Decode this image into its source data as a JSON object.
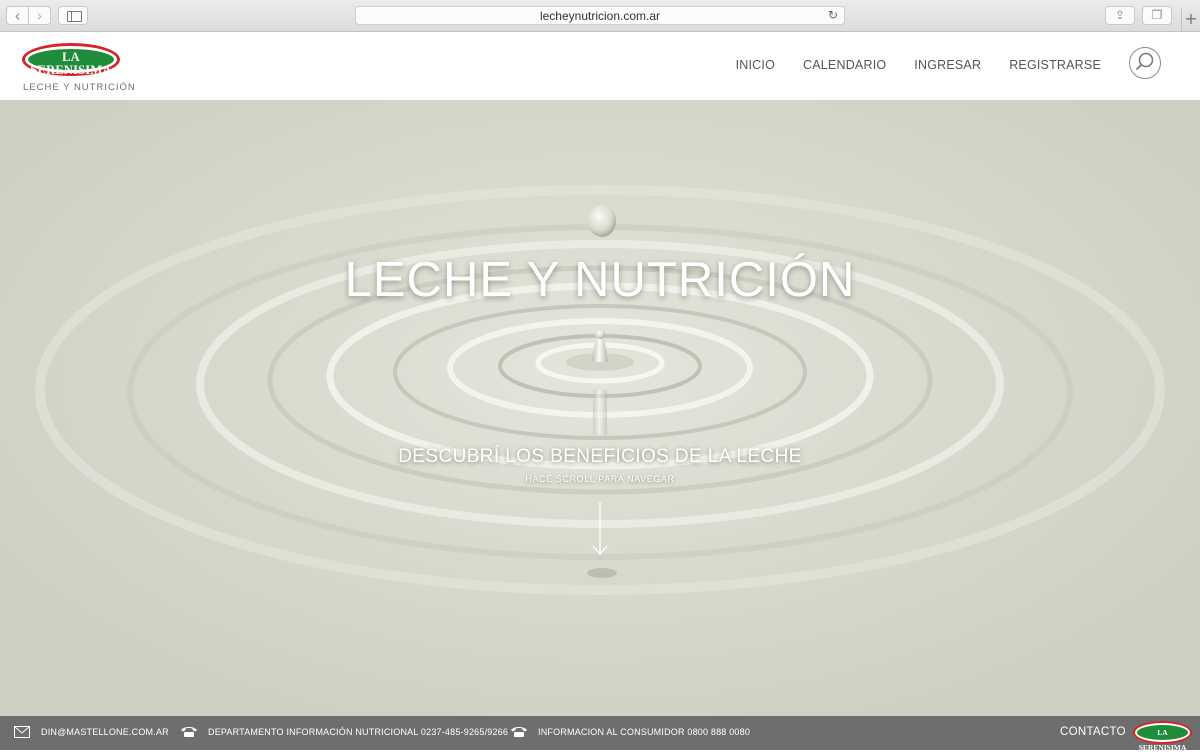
{
  "browser": {
    "url": "lecheynutricion.com.ar",
    "back_glyph": "‹",
    "forward_glyph": "›",
    "reload_glyph": "↻",
    "share_glyph": "⇪",
    "tabs_glyph": "❐",
    "new_tab_glyph": "+"
  },
  "header": {
    "logo": {
      "wordmark": "LA SERENISIMA",
      "tagline": "la verdad láctea"
    },
    "subtitle": "LECHE Y NUTRICIÓN",
    "nav": [
      {
        "label": "INICIO"
      },
      {
        "label": "CALENDARIO"
      },
      {
        "label": "INGRESAR"
      },
      {
        "label": "REGISTRARSE"
      }
    ],
    "search_icon": "search-icon"
  },
  "hero": {
    "title": "LECHE Y NUTRICIÓN",
    "cta": "DESCUBRÍ LOS BENEFICIOS DE LA LECHE",
    "hint": "HACÉ SCROLL PARA NAVEGAR",
    "scroll_icon": "arrow-down-icon"
  },
  "footer": {
    "email": "DIN@MASTELLONE.COM.AR",
    "phone_nutrition": "DEPARTAMENTO INFORMACIÓN NUTRICIONAL 0237-485-9265/9266",
    "phone_consumer": "INFORMACION AL CONSUMIDOR 0800 888 0080",
    "contact_label": "CONTACTO",
    "logo_wordmark": "LA SERENISIMA"
  },
  "colors": {
    "brand_green": "#1e8c3a",
    "brand_red": "#d8232a",
    "footer_bg": "#6e6e6e"
  }
}
